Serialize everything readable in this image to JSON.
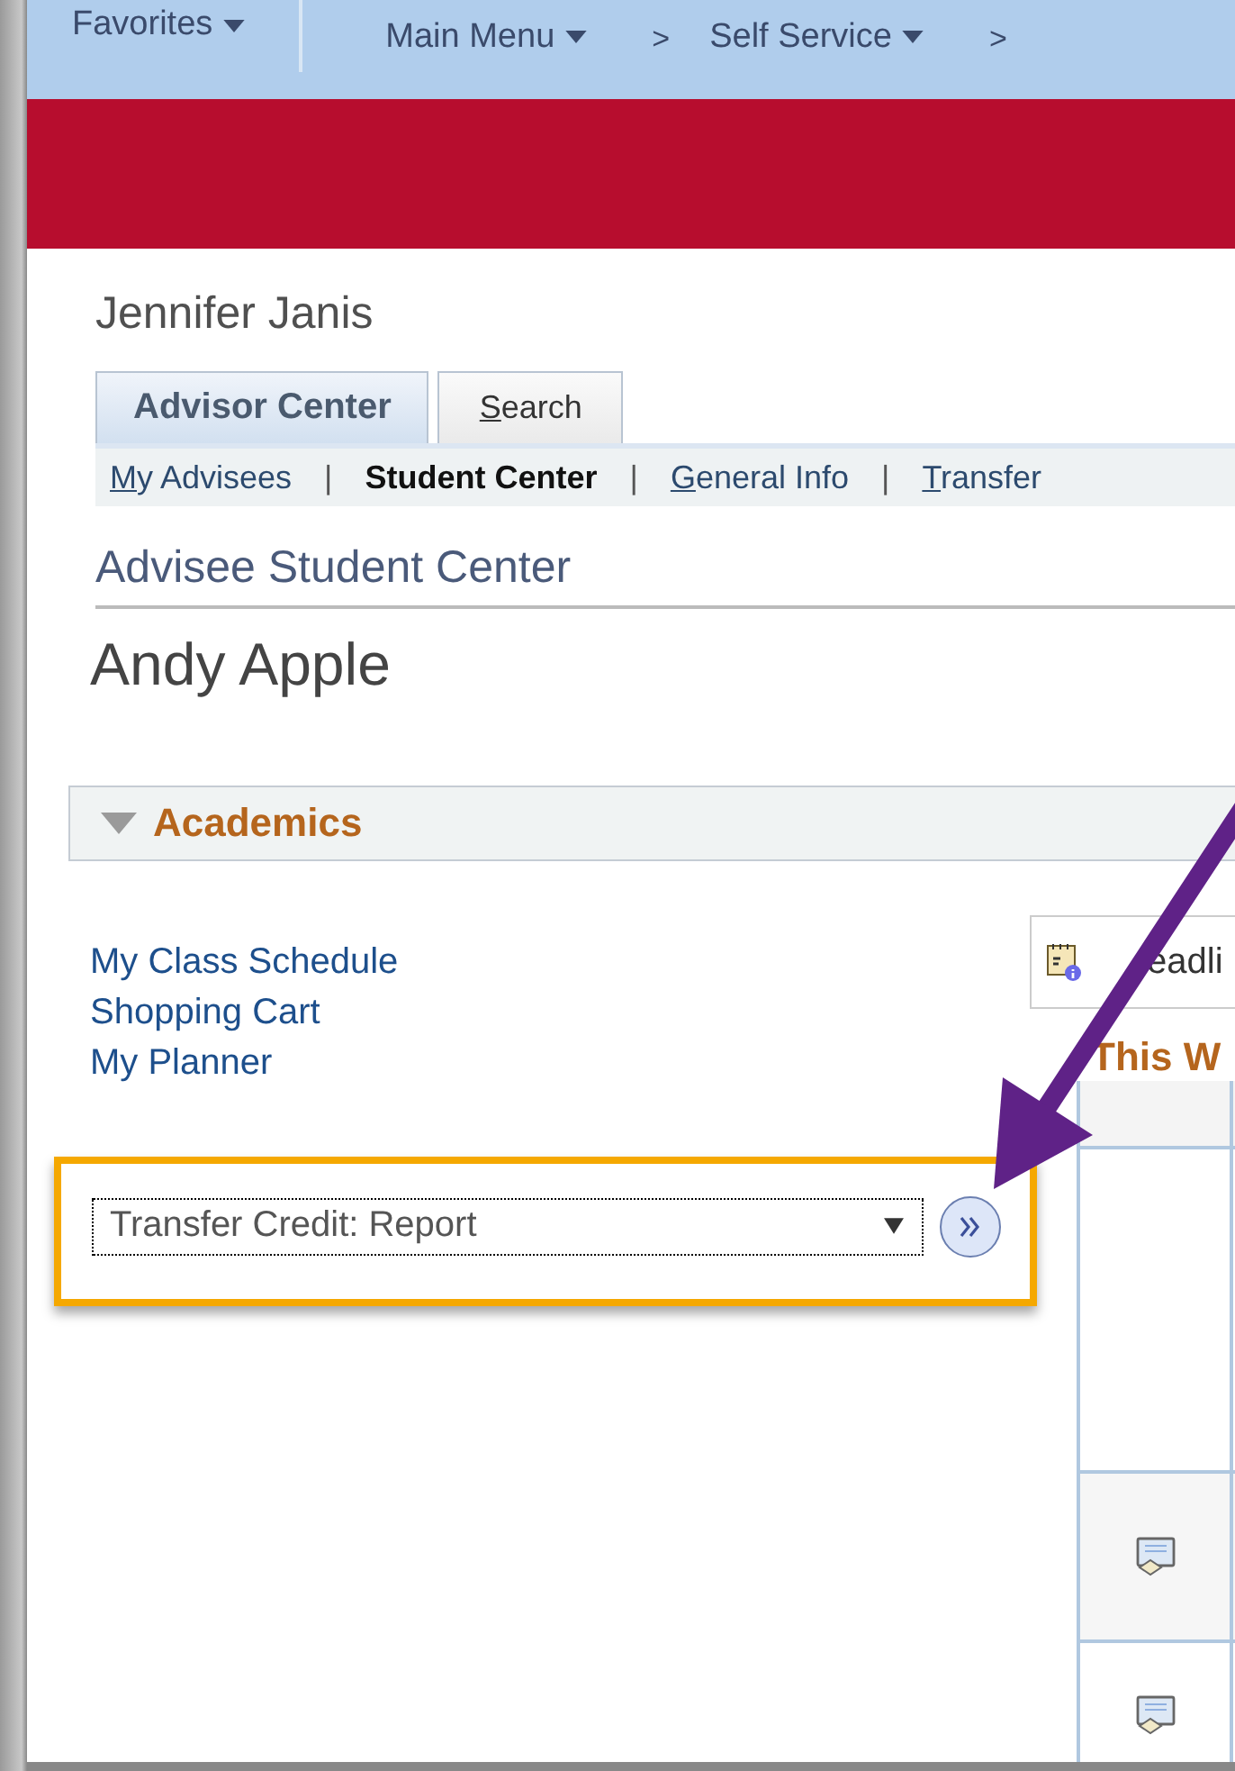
{
  "nav": {
    "items": [
      {
        "kind": "menu",
        "label": "Favorites"
      },
      {
        "kind": "menu",
        "label": "Main Menu"
      },
      {
        "kind": "separator",
        "label": ">"
      },
      {
        "kind": "menu",
        "label": "Self Service"
      },
      {
        "kind": "separator",
        "label": ">"
      }
    ]
  },
  "user_name": "Jennifer Janis",
  "tabs": [
    {
      "label": "Advisor Center",
      "selected": true,
      "underline_first": false
    },
    {
      "label": "Search",
      "selected": false,
      "underline_first": true
    }
  ],
  "subnav": [
    {
      "kind": "link",
      "label": "My Advisees",
      "selected": false,
      "underline_first": true
    },
    {
      "kind": "separator",
      "label": "|"
    },
    {
      "kind": "link",
      "label": "Student Center",
      "selected": true,
      "underline_first": false
    },
    {
      "kind": "separator",
      "label": "|"
    },
    {
      "kind": "link",
      "label": "General Info",
      "selected": false,
      "underline_first": true
    },
    {
      "kind": "separator",
      "label": "|"
    },
    {
      "kind": "link",
      "label": "Transfer",
      "selected": false,
      "underline_first": true
    }
  ],
  "page_title": "Advisee Student Center",
  "student_name": "Andy Apple",
  "section": {
    "title": "Academics",
    "expanded": true
  },
  "links": [
    "My Class Schedule",
    "Shopping Cart",
    "My Planner"
  ],
  "action_select": {
    "value": "Transfer Credit: Report",
    "highlighted": true
  },
  "deadlines": {
    "label": "eadli"
  },
  "week_heading": "This W"
}
